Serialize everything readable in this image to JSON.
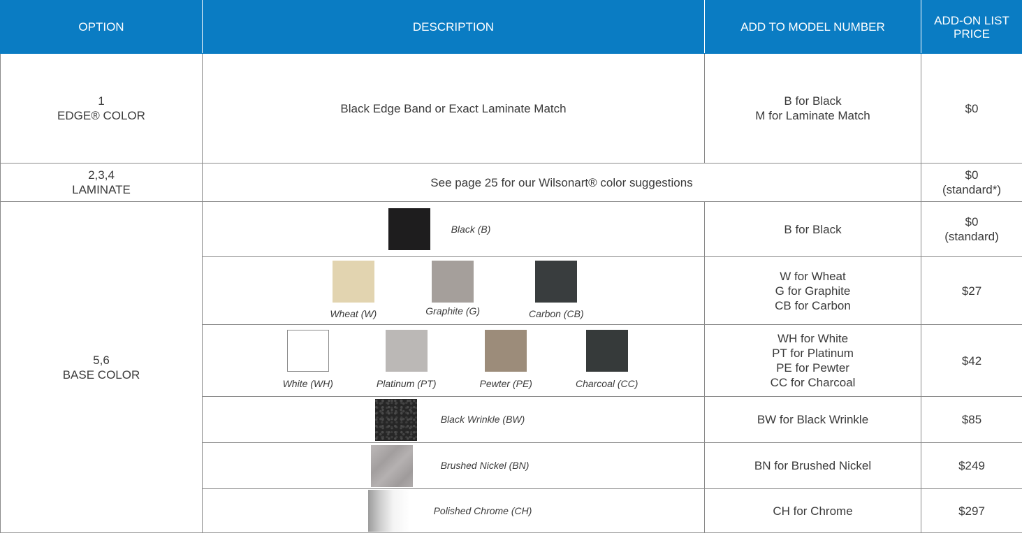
{
  "headers": {
    "option": "OPTION",
    "description": "DESCRIPTION",
    "add_to_model": "ADD TO MODEL NUMBER",
    "price": "ADD-ON LIST PRICE"
  },
  "rows": {
    "edge": {
      "option_num": "1",
      "option_name": "EDGE® COLOR",
      "description": "Black Edge Band or Exact Laminate Match",
      "codes": [
        "B for Black",
        "M for Laminate Match"
      ],
      "price": "$0"
    },
    "laminate": {
      "option_num": "2,3,4",
      "option_name": "LAMINATE",
      "description": "See page 25 for our Wilsonart® color suggestions",
      "price_line1": "$0",
      "price_line2": "(standard*)"
    },
    "base": {
      "option_num": "5,6",
      "option_name": "BASE COLOR",
      "black": {
        "label": "Black (B)",
        "color": "#1e1d1e",
        "codes": [
          "B for Black"
        ],
        "price_line1": "$0",
        "price_line2": "(standard)"
      },
      "group2": {
        "swatches": [
          {
            "label": "Wheat (W)",
            "color": "#e2d4b0"
          },
          {
            "label": "Graphite (G)",
            "color": "#a59f9b"
          },
          {
            "label": "Carbon (CB)",
            "color": "#393d3e"
          }
        ],
        "codes": [
          "W for Wheat",
          "G for Graphite",
          "CB for Carbon"
        ],
        "price": "$27"
      },
      "group3": {
        "swatches": [
          {
            "label": "White (WH)",
            "color": "#ffffff"
          },
          {
            "label": "Platinum (PT)",
            "color": "#bbb8b6"
          },
          {
            "label": "Pewter (PE)",
            "color": "#9c8c7a"
          },
          {
            "label": "Charcoal (CC)",
            "color": "#363a3a"
          }
        ],
        "codes": [
          "WH for White",
          "PT for Platinum",
          "PE for Pewter",
          "CC for Charcoal"
        ],
        "price": "$42"
      },
      "wrinkle": {
        "label": "Black Wrinkle (BW)",
        "color": "#2a2a2a",
        "codes": [
          "BW for Black Wrinkle"
        ],
        "price": "$85"
      },
      "nickel": {
        "label": "Brushed Nickel (BN)",
        "color": "#aeaaaa",
        "codes": [
          "BN for Brushed Nickel"
        ],
        "price": "$249"
      },
      "chrome": {
        "label": "Polished Chrome (CH)",
        "color": "#d8d8d8",
        "codes": [
          "CH for Chrome"
        ],
        "price": "$297"
      }
    }
  }
}
